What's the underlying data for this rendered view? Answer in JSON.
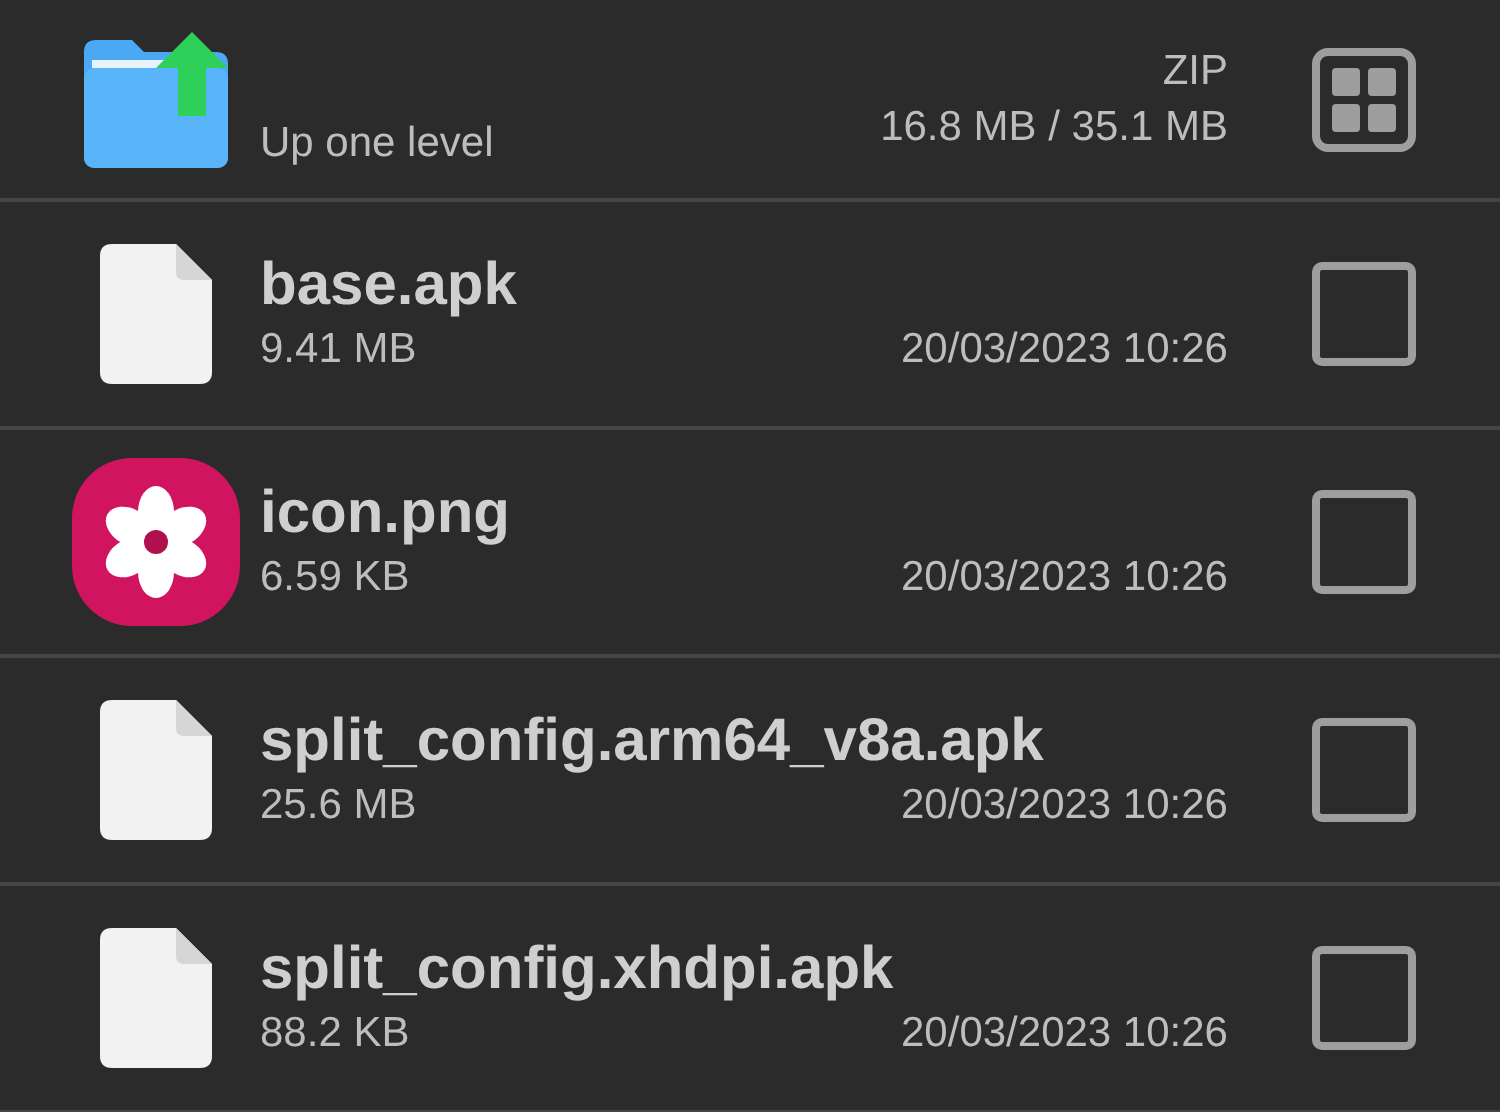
{
  "header": {
    "label": "Up one level",
    "archive_type": "ZIP",
    "size": "16.8 MB / 35.1 MB"
  },
  "files": [
    {
      "kind": "file",
      "name": "base.apk",
      "size": "9.41 MB",
      "modified": "20/03/2023 10:26",
      "checked": false
    },
    {
      "kind": "image",
      "name": "icon.png",
      "size": "6.59 KB",
      "modified": "20/03/2023 10:26",
      "checked": false
    },
    {
      "kind": "file",
      "name": "split_config.arm64_v8a.apk",
      "size": "25.6 MB",
      "modified": "20/03/2023 10:26",
      "checked": false
    },
    {
      "kind": "file",
      "name": "split_config.xhdpi.apk",
      "size": "88.2 KB",
      "modified": "20/03/2023 10:26",
      "checked": false
    }
  ]
}
